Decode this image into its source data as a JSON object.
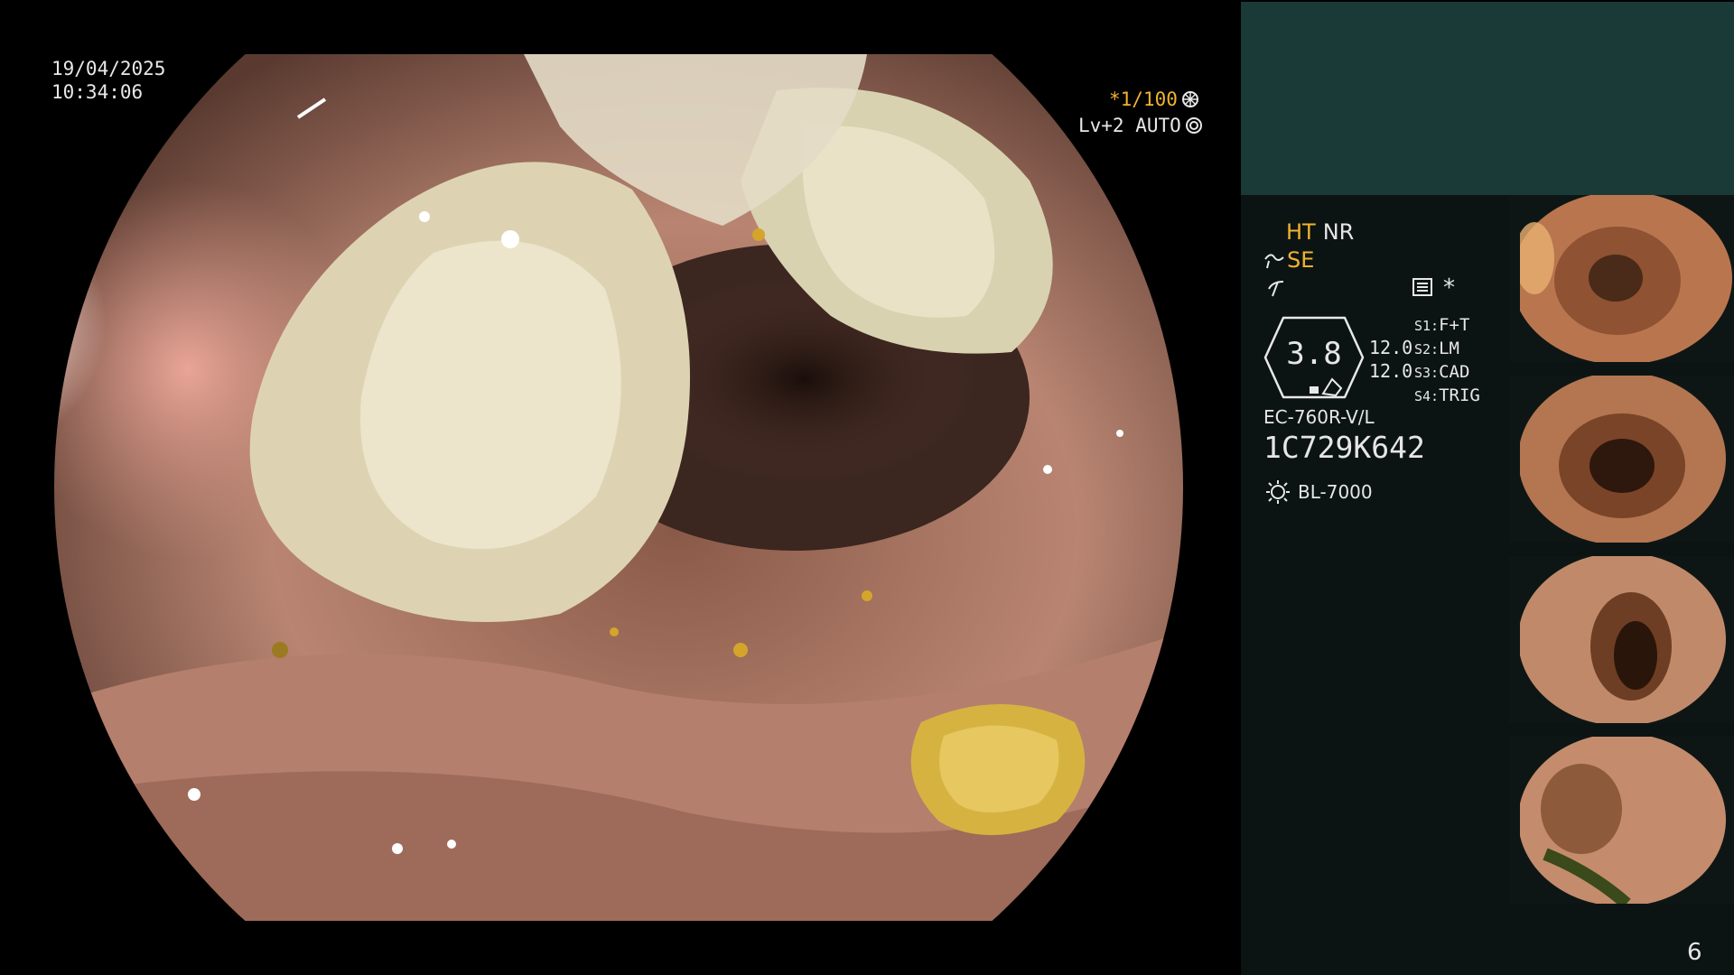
{
  "overlay": {
    "date": "19/04/2025",
    "time": "10:34:06",
    "zoom_label": "*1/100",
    "level_label": "Lv+2 AUTO"
  },
  "side": {
    "ht_label": "HT",
    "nr_label": "NR",
    "se_label": "SE",
    "pressure_value": "3.8",
    "readout_1": "12.0",
    "readout_2": "12.0",
    "switches": [
      {
        "key": "S1:",
        "value": "F+T"
      },
      {
        "key": "S2:",
        "value": "LM"
      },
      {
        "key": "S3:",
        "value": "CAD"
      },
      {
        "key": "S4:",
        "value": "TRIG"
      }
    ],
    "asterisk": "*",
    "scope_model": "EC-760R-V/L",
    "serial": "1C729K642",
    "light_source": "BL-7000",
    "page_number": "6"
  },
  "colors": {
    "accent_yellow": "#f2b230",
    "panel_dark": "#0c1413",
    "panel_teal": "#1a3a38"
  }
}
